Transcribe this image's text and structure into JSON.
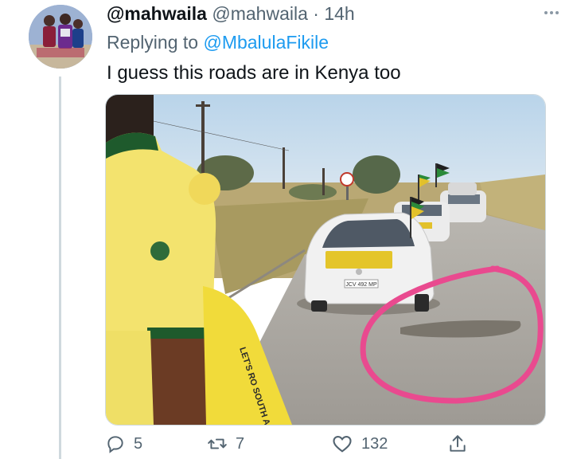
{
  "tweet": {
    "display_name": "@mahwaila",
    "handle": "@mahwaila",
    "separator": "·",
    "time": "14h",
    "replying_prefix": "Replying to ",
    "replying_to": "@MbalulaFikile",
    "text": "I guess this roads are in Kenya too"
  },
  "media": {
    "plate_text": "JCV 492 MP",
    "shirt_text": "LET'S RO SOUTH A TOGE"
  },
  "actions": {
    "replies": "5",
    "retweets": "7",
    "likes": "132"
  },
  "icons": {
    "more": "more-horizontal-icon",
    "reply": "reply-icon",
    "retweet": "retweet-icon",
    "like": "heart-icon",
    "share": "share-icon"
  },
  "colors": {
    "link": "#1d9bf0",
    "muted": "#536471",
    "text": "#0f1419",
    "circle_annotation": "#e94a8f"
  }
}
